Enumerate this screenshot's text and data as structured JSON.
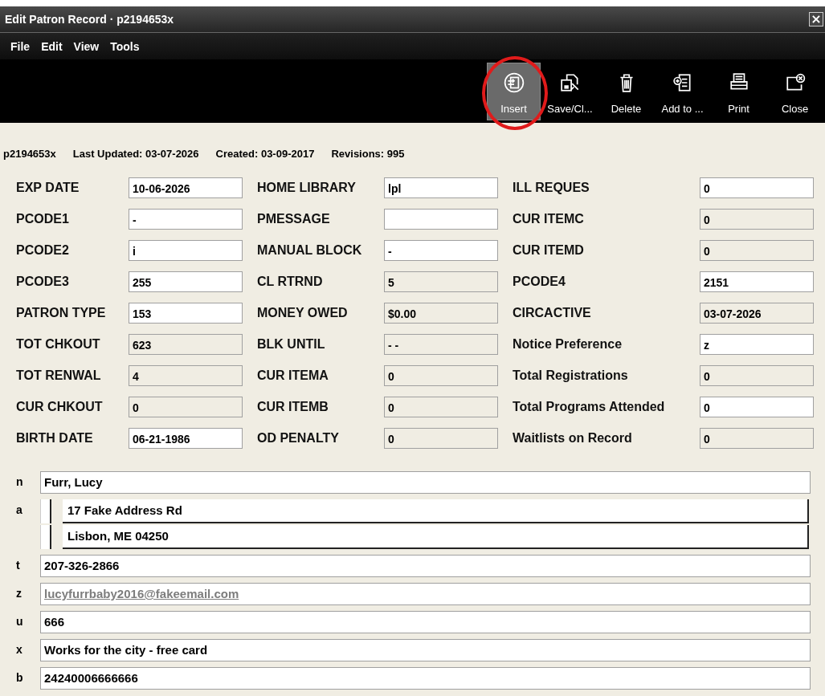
{
  "window": {
    "title": "Edit Patron Record · p2194653x",
    "close": "×"
  },
  "menu": [
    "File",
    "Edit",
    "View",
    "Tools"
  ],
  "toolbar": [
    {
      "label": "Insert",
      "kind": "insert",
      "selected": true,
      "circled": true
    },
    {
      "label": "Save/Cl...",
      "kind": "save",
      "selected": false,
      "circled": false
    },
    {
      "label": "Delete",
      "kind": "delete",
      "selected": false,
      "circled": false
    },
    {
      "label": "Add to ...",
      "kind": "add",
      "selected": false,
      "circled": false
    },
    {
      "label": "Print",
      "kind": "print",
      "selected": false,
      "circled": false
    },
    {
      "label": "Close",
      "kind": "close",
      "selected": false,
      "circled": false
    }
  ],
  "record_info": [
    "p2194653x",
    "Last Updated: 03-07-2026",
    "Created: 03-09-2017",
    "Revisions: 995"
  ],
  "fixed_fields": [
    {
      "label": "EXP DATE",
      "value": "10-06-2026",
      "editable": true
    },
    {
      "label": "HOME LIBRARY",
      "value": "lpl",
      "editable": true
    },
    {
      "label": "ILL REQUES",
      "value": "0",
      "editable": true
    },
    {
      "label": "PCODE1",
      "value": "-",
      "editable": true
    },
    {
      "label": "PMESSAGE",
      "editable": true
    },
    {
      "label": "CUR ITEMC",
      "value": "0",
      "editable": false
    },
    {
      "label": "PCODE2",
      "value": "i",
      "editable": true
    },
    {
      "label": "MANUAL BLOCK",
      "value": "-",
      "editable": true
    },
    {
      "label": "CUR ITEMD",
      "value": "0",
      "editable": false
    },
    {
      "label": "PCODE3",
      "value": "255",
      "editable": true
    },
    {
      "label": "CL RTRND",
      "value": "5",
      "editable": false
    },
    {
      "label": "PCODE4",
      "value": "2151",
      "editable": true
    },
    {
      "label": "PATRON TYPE",
      "value": "153",
      "editable": true
    },
    {
      "label": "MONEY OWED",
      "value": "$0.00",
      "editable": false
    },
    {
      "label": "CIRCACTIVE",
      "value": "03-07-2026",
      "editable": false
    },
    {
      "label": "TOT CHKOUT",
      "value": "623",
      "editable": false
    },
    {
      "label": "BLK UNTIL",
      "value": "- -",
      "editable": false
    },
    {
      "label": "Notice Preference",
      "value": "z",
      "editable": true
    },
    {
      "label": "TOT RENWAL",
      "value": "4",
      "editable": false
    },
    {
      "label": "CUR ITEMA",
      "value": "0",
      "editable": false
    },
    {
      "label": "Total Registrations",
      "value": "0",
      "editable": false
    },
    {
      "label": "CUR CHKOUT",
      "value": "0",
      "editable": false
    },
    {
      "label": "CUR ITEMB",
      "value": "0",
      "editable": false
    },
    {
      "label": "Total Programs Attended",
      "value": "0",
      "editable": true
    },
    {
      "label": "BIRTH DATE",
      "value": "06-21-1986",
      "editable": true
    },
    {
      "label": "OD PENALTY",
      "value": "0",
      "editable": false
    },
    {
      "label": "Waitlists on Record",
      "value": "0",
      "editable": false
    }
  ],
  "variable_fields": [
    {
      "tag": "n",
      "kind": "text",
      "value": "Furr, Lucy"
    },
    {
      "tag": "a",
      "kind": "address",
      "lines": [
        "17 Fake Address Rd",
        "Lisbon, ME 04250"
      ]
    },
    {
      "tag": "t",
      "kind": "text",
      "value": "207-326-2866"
    },
    {
      "tag": "z",
      "kind": "link",
      "value": "lucyfurrbaby2016@fakeemail.com"
    },
    {
      "tag": "u",
      "kind": "text",
      "value": "666"
    },
    {
      "tag": "x",
      "kind": "text",
      "value": "Works for the city - free card"
    },
    {
      "tag": "b",
      "kind": "text",
      "value": "24240006666666"
    }
  ]
}
